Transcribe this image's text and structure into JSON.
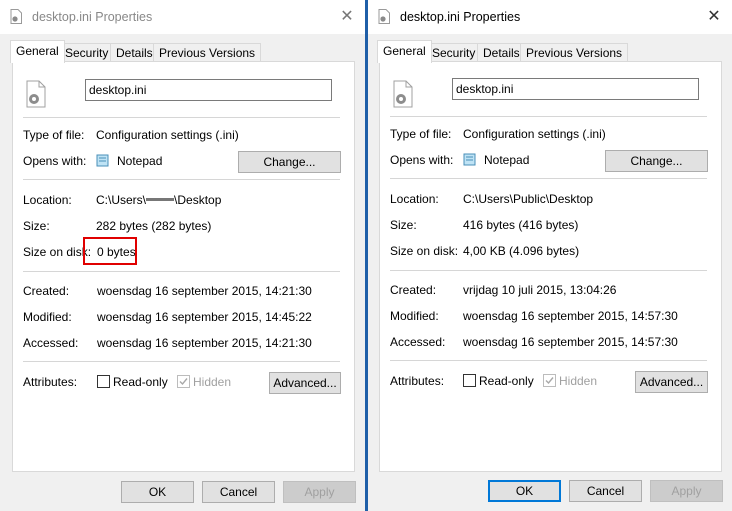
{
  "left": {
    "title": "desktop.ini Properties",
    "tabs": [
      "General",
      "Security",
      "Details",
      "Previous Versions"
    ],
    "filename": "desktop.ini",
    "type_label": "Type of file:",
    "type_value": "Configuration settings (.ini)",
    "opens_label": "Opens with:",
    "opens_value": "Notepad",
    "change_label": "Change...",
    "location_label": "Location:",
    "location_prefix": "C:\\Users\\",
    "location_suffix": "\\Desktop",
    "size_label": "Size:",
    "size_value": "282 bytes (282 bytes)",
    "disk_label": "Size on disk:",
    "disk_value": "0 bytes",
    "created_label": "Created:",
    "created_value": "woensdag 16 september 2015, 14:21:30",
    "modified_label": "Modified:",
    "modified_value": "woensdag 16 september 2015, 14:45:22",
    "accessed_label": "Accessed:",
    "accessed_value": "woensdag 16 september 2015, 14:21:30",
    "attributes_label": "Attributes:",
    "readonly_label": "Read-only",
    "hidden_label": "Hidden",
    "advanced_label": "Advanced...",
    "ok_label": "OK",
    "cancel_label": "Cancel",
    "apply_label": "Apply"
  },
  "right": {
    "title": "desktop.ini Properties",
    "tabs": [
      "General",
      "Security",
      "Details",
      "Previous Versions"
    ],
    "filename": "desktop.ini",
    "type_label": "Type of file:",
    "type_value": "Configuration settings (.ini)",
    "opens_label": "Opens with:",
    "opens_value": "Notepad",
    "change_label": "Change...",
    "location_label": "Location:",
    "location_value": "C:\\Users\\Public\\Desktop",
    "size_label": "Size:",
    "size_value": "416 bytes (416 bytes)",
    "disk_label": "Size on disk:",
    "disk_value": "4,00 KB (4.096 bytes)",
    "created_label": "Created:",
    "created_value": "vrijdag 10 juli 2015, 13:04:26",
    "modified_label": "Modified:",
    "modified_value": "woensdag 16 september 2015, 14:57:30",
    "accessed_label": "Accessed:",
    "accessed_value": "woensdag 16 september 2015, 14:57:30",
    "attributes_label": "Attributes:",
    "readonly_label": "Read-only",
    "hidden_label": "Hidden",
    "advanced_label": "Advanced...",
    "ok_label": "OK",
    "cancel_label": "Cancel",
    "apply_label": "Apply"
  },
  "colors": {
    "highlight": "#e00000",
    "accent_blue": "#1f5fa8",
    "focus_blue": "#0078d7"
  }
}
